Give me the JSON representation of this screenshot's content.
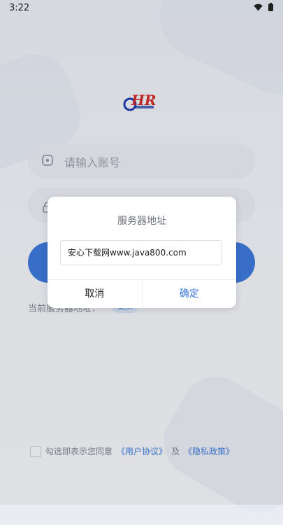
{
  "status": {
    "time": "3:22"
  },
  "login": {
    "account_placeholder": "请输入账号",
    "server_label": "当前服务器地址：",
    "change_label": "更换"
  },
  "dialog": {
    "title": "服务器地址",
    "input_value": "安心下载网www.java800.com",
    "cancel": "取消",
    "confirm": "确定"
  },
  "agreement": {
    "prefix": "勾选即表示您同意",
    "user_agreement": "《用户协议》",
    "and": "及",
    "privacy_policy": "《隐私政策》"
  },
  "colors": {
    "accent": "#3d78d8",
    "logo_blue": "#1f3aa8",
    "logo_red": "#d12b2b"
  }
}
